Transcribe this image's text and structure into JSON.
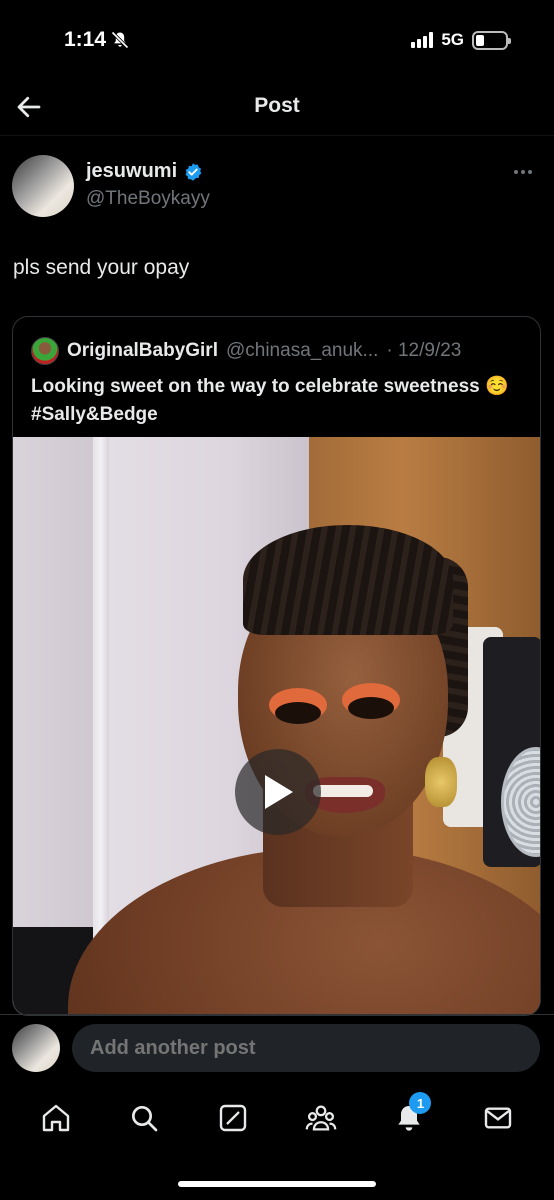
{
  "status_bar": {
    "time": "1:14",
    "network": "5G",
    "silent_icon": "bell-slash-icon"
  },
  "header": {
    "title": "Post",
    "back_icon": "arrow-left-icon"
  },
  "post": {
    "author_name": "jesuwumi",
    "author_handle": "@TheBoykayy",
    "verified": true,
    "text": "pls send your opay",
    "more_icon": "ellipsis-icon"
  },
  "quoted": {
    "author_name": "OriginalBabyGirl",
    "author_handle": "@chinasa_anuk...",
    "date": "· 12/9/23",
    "text": "Looking sweet on the way to celebrate sweetness ☺️#Sally&Bedge",
    "media": {
      "type": "video",
      "play_icon": "play-icon"
    }
  },
  "reply": {
    "placeholder": "Add another post"
  },
  "nav": {
    "items": [
      "home-icon",
      "search-icon",
      "compose-icon",
      "communities-icon",
      "notifications-icon",
      "messages-icon"
    ],
    "notifications_badge": "1"
  },
  "colors": {
    "accent": "#1d9bf0",
    "background": "#000000",
    "muted": "#71767b"
  }
}
